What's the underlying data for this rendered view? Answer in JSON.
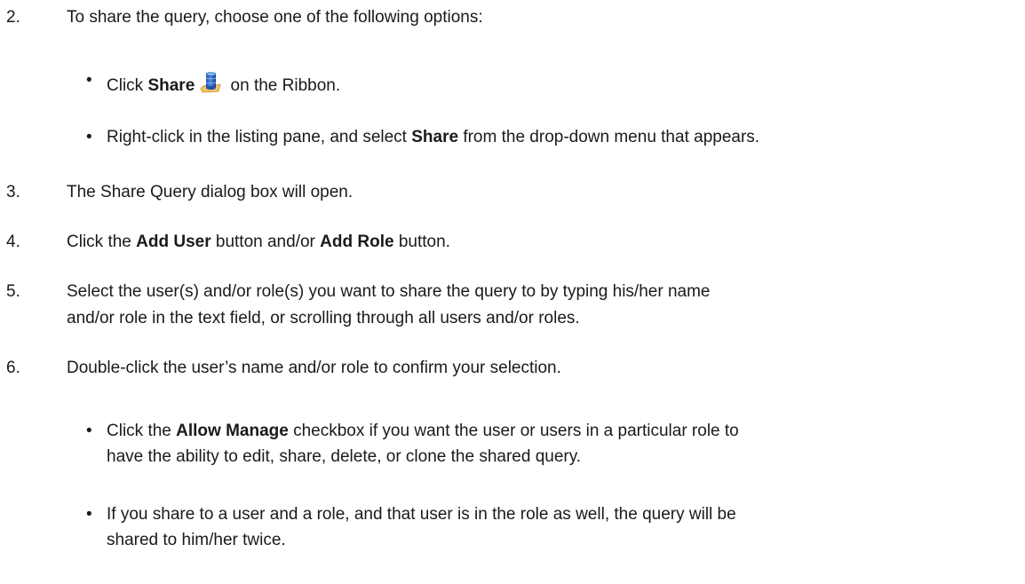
{
  "steps": [
    {
      "number": "2.",
      "text": "To share the query, choose one of the following options:",
      "bullets": [
        {
          "pre": "Click ",
          "bold": "Share",
          "icon": "share-database-icon",
          "post": " on the Ribbon."
        },
        {
          "pre": "Right-click in the listing pane, and select ",
          "bold": "Share",
          "post": " from the drop-down menu that appears."
        }
      ]
    },
    {
      "number": "3.",
      "text": "The Share Query dialog box will open."
    },
    {
      "number": "4.",
      "pre": "Click the ",
      "bold1": "Add User",
      "mid": " button and/or ",
      "bold2": "Add Role",
      "post": " button."
    },
    {
      "number": "5.",
      "line1": "Select the user(s) and/or role(s) you want to share the query to by typing his/her name",
      "line2": "and/or role in the text field, or scrolling through all users and/or roles."
    },
    {
      "number": "6.",
      "text": "Double-click the user’s name and/or role to confirm your selection.",
      "bullets": [
        {
          "pre": "Click the ",
          "bold": "Allow Manage",
          "post": " checkbox if you want the user or users in a particular role to",
          "line2": "have the ability to edit, share, delete, or clone the shared query."
        },
        {
          "line1": "If you share to a user and a role, and that user is in the role as well, the query will be",
          "line2": "shared to him/her twice."
        }
      ]
    }
  ],
  "bullet_glyph": "•"
}
